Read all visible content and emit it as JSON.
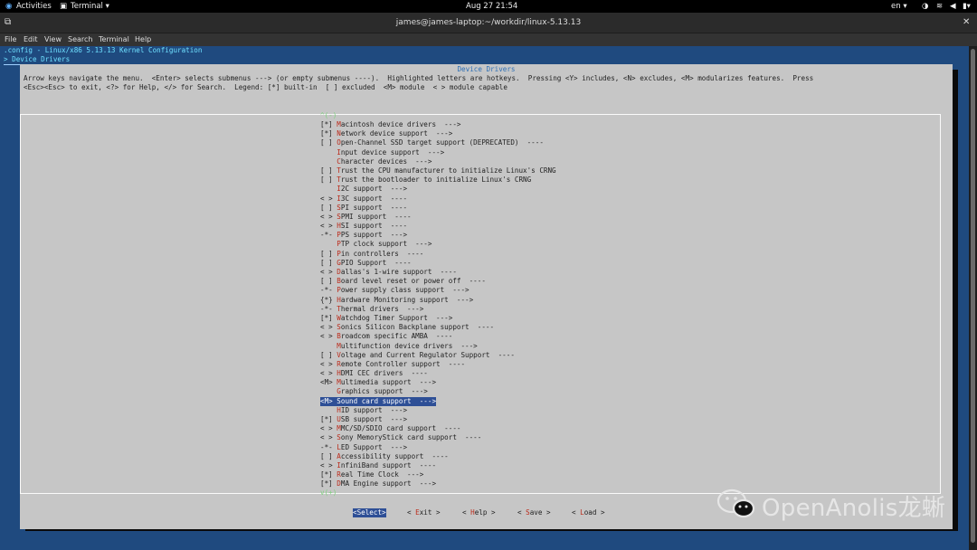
{
  "topbar": {
    "activities": "Activities",
    "app": "Terminal ▾",
    "clock": "Aug 27  21:54",
    "lang": "en ▾"
  },
  "window": {
    "title": "james@james-laptop:~/workdir/linux-5.13.13"
  },
  "menubar": [
    "File",
    "Edit",
    "View",
    "Search",
    "Terminal",
    "Help"
  ],
  "header": {
    "config_line": ".config - Linux/x86 5.13.13 Kernel Configuration",
    "path_line": "> Device Drivers"
  },
  "dialog": {
    "title": "Device Drivers",
    "help1": "Arrow keys navigate the menu.  <Enter> selects submenus ---> (or empty submenus ----).  Highlighted letters are hotkeys.  Pressing <Y> includes, <N> excludes, <M> modularizes features.  Press",
    "help2": "<Esc><Esc> to exit, <?> for Help, </> for Search.  Legend: [*] built-in  [ ] excluded  <M> module  < > module capable",
    "more_above": "^(-)",
    "more_below": "v(+)"
  },
  "menu": [
    {
      "p": "[*] ",
      "h": "M",
      "r": "acintosh device drivers  --->"
    },
    {
      "p": "[*] ",
      "h": "N",
      "r": "etwork device support  --->"
    },
    {
      "p": "[ ] ",
      "h": "O",
      "r": "pen-Channel SSD target support (DEPRECATED)  ----"
    },
    {
      "p": "    ",
      "h": "I",
      "r": "nput device support  --->"
    },
    {
      "p": "    ",
      "h": "C",
      "r": "haracter devices  --->"
    },
    {
      "p": "[ ] ",
      "h": "T",
      "r": "rust the CPU manufacturer to initialize Linux's CRNG"
    },
    {
      "p": "[ ] ",
      "h": "T",
      "r": "rust the bootloader to initialize Linux's CRNG"
    },
    {
      "p": "    ",
      "h": "I",
      "r": "2C support  --->"
    },
    {
      "p": "< > ",
      "h": "I",
      "r": "3C support  ----"
    },
    {
      "p": "[ ] ",
      "h": "S",
      "r": "PI support  ----"
    },
    {
      "p": "< > ",
      "h": "S",
      "r": "PMI support  ----"
    },
    {
      "p": "< > ",
      "h": "H",
      "r": "SI support  ----"
    },
    {
      "p": "-*- ",
      "h": "P",
      "r": "PS support  --->"
    },
    {
      "p": "    ",
      "h": "P",
      "r": "TP clock support  --->"
    },
    {
      "p": "[ ] ",
      "h": "P",
      "r": "in controllers  ----"
    },
    {
      "p": "[ ] ",
      "h": "G",
      "r": "PIO Support  ----"
    },
    {
      "p": "< > ",
      "h": "D",
      "r": "allas's 1-wire support  ----"
    },
    {
      "p": "[ ] ",
      "h": "B",
      "r": "oard level reset or power off  ----"
    },
    {
      "p": "-*- ",
      "h": "P",
      "r": "ower supply class support  --->"
    },
    {
      "p": "{*} ",
      "h": "H",
      "r": "ardware Monitoring support  --->"
    },
    {
      "p": "-*- ",
      "h": "T",
      "r": "hermal drivers  --->"
    },
    {
      "p": "[*] ",
      "h": "W",
      "r": "atchdog Timer Support  --->"
    },
    {
      "p": "< > ",
      "h": "S",
      "r": "onics Silicon Backplane support  ----"
    },
    {
      "p": "< > ",
      "h": "B",
      "r": "roadcom specific AMBA  ----"
    },
    {
      "p": "    ",
      "h": "M",
      "r": "ultifunction device drivers  --->"
    },
    {
      "p": "[ ] ",
      "h": "V",
      "r": "oltage and Current Regulator Support  ----"
    },
    {
      "p": "< > ",
      "h": "R",
      "r": "emote Controller support  ----"
    },
    {
      "p": "< > ",
      "h": "H",
      "r": "DMI CEC drivers  ----"
    },
    {
      "p": "<M> ",
      "h": "M",
      "r": "ultimedia support  --->"
    },
    {
      "p": "    ",
      "h": "G",
      "r": "raphics support  --->"
    },
    {
      "p": "<M> ",
      "h": "S",
      "r": "ound card support  --->"
    },
    {
      "p": "    ",
      "h": "H",
      "r": "ID support  --->"
    },
    {
      "p": "[*] ",
      "h": "U",
      "r": "SB support  --->"
    },
    {
      "p": "< > ",
      "h": "M",
      "r": "MC/SD/SDIO card support  ----"
    },
    {
      "p": "< > ",
      "h": "S",
      "r": "ony MemoryStick card support  ----"
    },
    {
      "p": "-*- ",
      "h": "L",
      "r": "ED Support  --->"
    },
    {
      "p": "[ ] ",
      "h": "A",
      "r": "ccessibility support  ----"
    },
    {
      "p": "< > ",
      "h": "I",
      "r": "nfiniBand support  ----"
    },
    {
      "p": "[*] ",
      "h": "R",
      "r": "eal Time Clock  --->"
    },
    {
      "p": "[*] ",
      "h": "D",
      "r": "MA Engine support  --->"
    }
  ],
  "selected_index": 30,
  "buttons": [
    {
      "a": "<",
      "h": "S",
      "b": "elect>"
    },
    {
      "a": "< ",
      "h": "E",
      "b": "xit >"
    },
    {
      "a": "< ",
      "h": "H",
      "b": "elp >"
    },
    {
      "a": "< ",
      "h": "S",
      "b": "ave >"
    },
    {
      "a": "< ",
      "h": "L",
      "b": "oad >"
    }
  ],
  "watermark": "OpenAnolis龙蜥",
  "colors": {
    "terminal_bg": "#1f4a7f",
    "dialog_bg": "#c6c6c6",
    "highlight": "#2e4f96",
    "hotkey": "#bb2a1a",
    "header_text": "#6fe0ff"
  }
}
